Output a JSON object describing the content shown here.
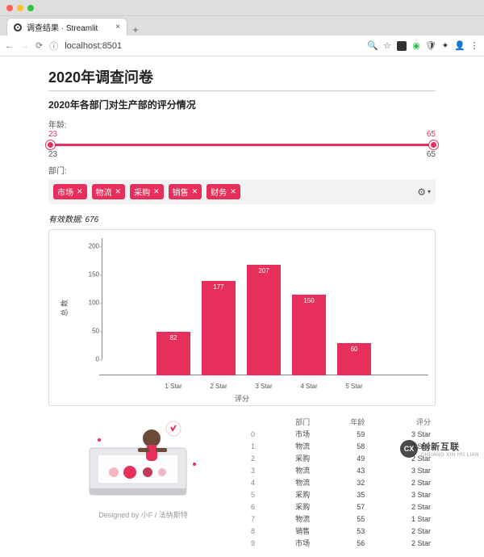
{
  "browser": {
    "tab_title": "调查结果 · Streamlit",
    "url": "localhost:8501"
  },
  "page": {
    "title": "2020年调查问卷",
    "subtitle": "2020年各部门对生产部的评分情况",
    "age_label": "年龄:",
    "age_val_low": "23",
    "age_val_high": "65",
    "age_min": "23",
    "age_max": "65",
    "dept_label": "部门:",
    "chips": [
      "市场",
      "物流",
      "采购",
      "销售",
      "财务"
    ],
    "valid_data": "有效数据: 676",
    "ylabel": "总\n数",
    "yticks": [
      "0",
      "50",
      "100",
      "150",
      "200"
    ],
    "xlabel": "评分",
    "credit": "Designed by 小F / 法纳斯特"
  },
  "chart_data": {
    "type": "bar",
    "title": "",
    "xlabel": "评分",
    "ylabel": "总数",
    "categories": [
      "1 Star",
      "2 Star",
      "3 Star",
      "4 Star",
      "5 Star"
    ],
    "values": [
      82,
      177,
      207,
      150,
      60
    ],
    "ylim": [
      0,
      210
    ]
  },
  "table": {
    "headers": [
      "部门",
      "年龄",
      "评分"
    ],
    "rows": [
      {
        "i": "0",
        "d": "市场",
        "a": "59",
        "r": "3 Star"
      },
      {
        "i": "1",
        "d": "物流",
        "a": "58",
        "r": "2 Star"
      },
      {
        "i": "2",
        "d": "采购",
        "a": "49",
        "r": "2 Star"
      },
      {
        "i": "3",
        "d": "物流",
        "a": "43",
        "r": "3 Star"
      },
      {
        "i": "4",
        "d": "物流",
        "a": "32",
        "r": "2 Star"
      },
      {
        "i": "5",
        "d": "采购",
        "a": "35",
        "r": "3 Star"
      },
      {
        "i": "6",
        "d": "采购",
        "a": "57",
        "r": "2 Star"
      },
      {
        "i": "7",
        "d": "物流",
        "a": "55",
        "r": "1 Star"
      },
      {
        "i": "8",
        "d": "销售",
        "a": "53",
        "r": "2 Star"
      },
      {
        "i": "9",
        "d": "市场",
        "a": "56",
        "r": "2 Star"
      }
    ]
  },
  "watermark": {
    "main": "创新互联",
    "sub": "CHUANG XIN HU LIAN",
    "badge": "CX"
  }
}
